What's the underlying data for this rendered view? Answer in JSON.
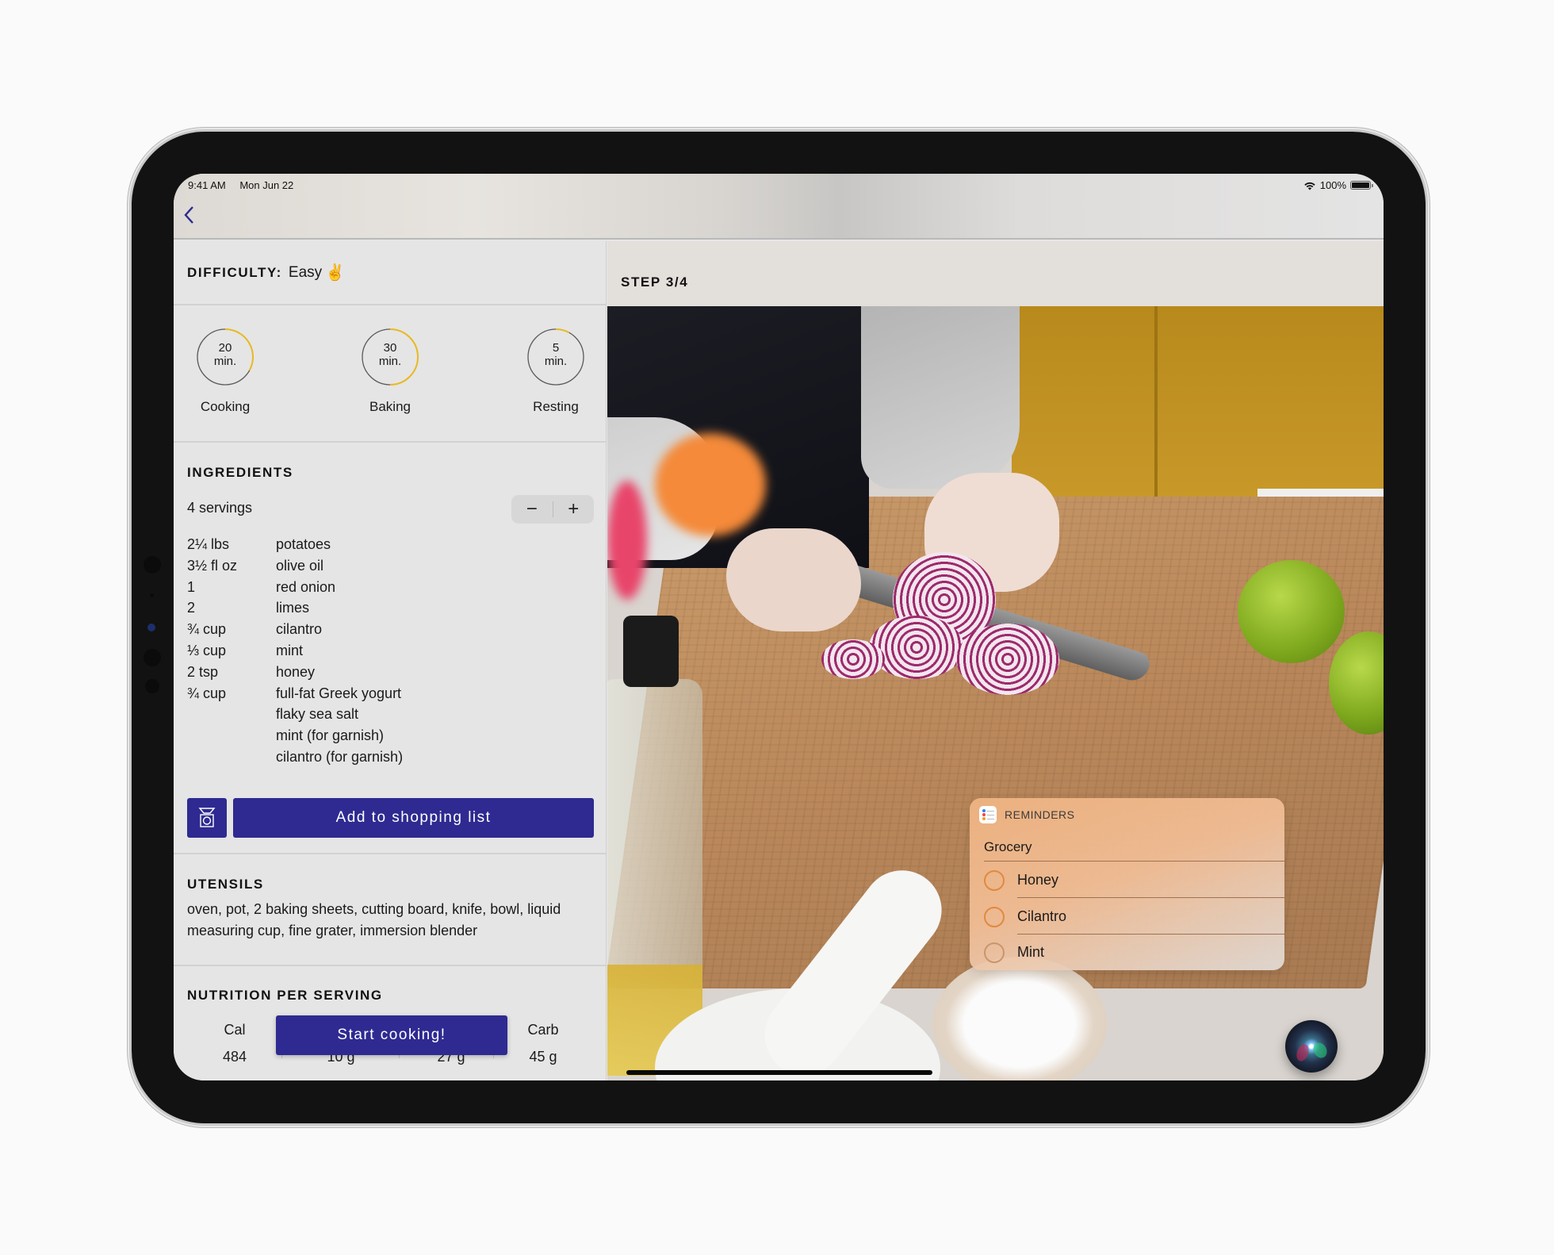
{
  "status_bar": {
    "time": "9:41 AM",
    "date": "Mon Jun 22",
    "battery": "100%",
    "wifi_icon": "wifi-icon",
    "battery_icon": "battery-icon"
  },
  "nav": {
    "back_icon": "chevron-left-icon",
    "back_glyph": "‹"
  },
  "difficulty": {
    "label": "DIFFICULTY:",
    "value": "Easy",
    "emoji": "✌"
  },
  "timers": [
    {
      "value": "20",
      "unit": "min.",
      "label": "Cooking",
      "progress": 0.33
    },
    {
      "value": "30",
      "unit": "min.",
      "label": "Baking",
      "progress": 0.5
    },
    {
      "value": "5",
      "unit": "min.",
      "label": "Resting",
      "progress": 0.08
    }
  ],
  "ingredients": {
    "title": "INGREDIENTS",
    "servings": "4 servings",
    "stepper_minus": "−",
    "stepper_plus": "+",
    "items": [
      {
        "qty": "2¼ lbs",
        "name": "potatoes"
      },
      {
        "qty": "3½ fl oz",
        "name": "olive oil"
      },
      {
        "qty": "1",
        "name": "red onion"
      },
      {
        "qty": "2",
        "name": "limes"
      },
      {
        "qty": "¾ cup",
        "name": "cilantro"
      },
      {
        "qty": "⅓ cup",
        "name": "mint"
      },
      {
        "qty": "2 tsp",
        "name": "honey"
      },
      {
        "qty": "¾ cup",
        "name": "full-fat Greek yogurt"
      },
      {
        "qty": "",
        "name": "flaky sea salt"
      },
      {
        "qty": "",
        "name": "mint (for garnish)"
      },
      {
        "qty": "",
        "name": "cilantro (for garnish)"
      }
    ],
    "scale_icon": "kitchen-scale-icon",
    "add_to_list": "Add to shopping list"
  },
  "utensils": {
    "title": "UTENSILS",
    "text": "oven, pot, 2 baking sheets, cutting board, knife, bowl, liquid measuring cup, fine grater, immersion blender"
  },
  "nutrition": {
    "title": "NUTRITION PER SERVING",
    "columns": [
      {
        "label": "Cal",
        "value": "484"
      },
      {
        "label": "",
        "value": "10 g"
      },
      {
        "label": "",
        "value": "27 g"
      },
      {
        "label": "Carb",
        "value": "45 g"
      }
    ],
    "start_button": "Start cooking!"
  },
  "step": {
    "label": "STEP 3/4"
  },
  "reminders": {
    "app_name": "REMINDERS",
    "list_name": "Grocery",
    "items": [
      {
        "text": "Honey",
        "done": false
      },
      {
        "text": "Cilantro",
        "done": false
      },
      {
        "text": "Mint",
        "done": false
      }
    ]
  },
  "colors": {
    "accent": "#2e2a91",
    "timer_progress": "#e8b923",
    "reminder_circle": "#e08a3f"
  }
}
